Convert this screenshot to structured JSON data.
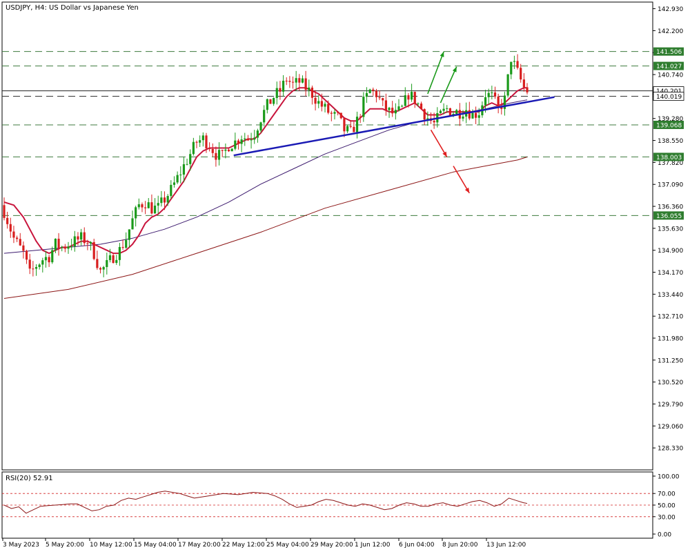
{
  "header": {
    "title": "USDJPY, H4:  US Dollar vs Japanese Yen"
  },
  "colors": {
    "bull_candle": "#1a9a1a",
    "bear_candle": "#d81e1e",
    "ma_fast": "#c8143c",
    "ma_mid": "#3c1a6e",
    "ma_slow": "#8b1414",
    "trendline": "#1a1ab4",
    "level_dash": "#3c7a3c",
    "level_label_bg": "#2f7d2f",
    "arrow_up": "#1a9a1a",
    "arrow_down": "#e02020",
    "rsi_line": "#8b1414",
    "rsi_levels": "#d22020"
  },
  "chart_data": [
    {
      "type": "candlestick",
      "symbol": "USDJPY",
      "timeframe": "H4",
      "ylim": [
        127.6,
        143.15
      ],
      "y_ticks": [
        "142.930",
        "142.200",
        "141.470",
        "140.740",
        "140.010",
        "139.280",
        "138.550",
        "137.820",
        "137.090",
        "136.360",
        "135.630",
        "134.900",
        "134.170",
        "133.440",
        "132.710",
        "131.980",
        "131.250",
        "130.520",
        "129.790",
        "129.060",
        "128.330"
      ],
      "x_labels": [
        "3 May 2023",
        "5 May 20:00",
        "10 May 12:00",
        "15 May 04:00",
        "17 May 20:00",
        "22 May 12:00",
        "25 May 04:00",
        "29 May 20:00",
        "1 Jun 12:00",
        "6 Jun 04:00",
        "8 Jun 20:00",
        "13 Jun 12:00"
      ],
      "price_levels": [
        {
          "value": 141.506,
          "label": "141.506",
          "style": "dashed-labeled"
        },
        {
          "value": 141.027,
          "label": "141.027",
          "style": "dashed-labeled"
        },
        {
          "value": 140.201,
          "label": "140.201",
          "style": "solid-current"
        },
        {
          "value": 140.019,
          "label": "140.019",
          "style": "dashed-dark"
        },
        {
          "value": 139.068,
          "label": "139.068",
          "style": "dashed-labeled"
        },
        {
          "value": 138.003,
          "label": "138.003",
          "style": "dashed-labeled"
        },
        {
          "value": 136.055,
          "label": "136.055",
          "style": "dashed-labeled"
        }
      ],
      "close_path": [
        [
          0,
          136.2
        ],
        [
          3,
          135.3
        ],
        [
          6,
          134.8
        ],
        [
          8,
          134.1
        ],
        [
          10,
          134.4
        ],
        [
          12,
          134.6
        ],
        [
          14,
          134.7
        ],
        [
          16,
          135.1
        ],
        [
          18,
          135.0
        ],
        [
          20,
          135.1
        ],
        [
          22,
          135.2
        ],
        [
          24,
          135.3
        ],
        [
          26,
          135.2
        ],
        [
          28,
          134.8
        ],
        [
          30,
          134.2
        ],
        [
          32,
          134.4
        ],
        [
          34,
          134.7
        ],
        [
          36,
          134.9
        ],
        [
          38,
          135.3
        ],
        [
          40,
          135.9
        ],
        [
          42,
          136.4
        ],
        [
          44,
          136.5
        ],
        [
          46,
          136.3
        ],
        [
          48,
          136.3
        ],
        [
          50,
          136.6
        ],
        [
          52,
          136.9
        ],
        [
          54,
          137.3
        ],
        [
          56,
          137.7
        ],
        [
          58,
          138.1
        ],
        [
          60,
          138.5
        ],
        [
          62,
          138.6
        ],
        [
          64,
          138.4
        ],
        [
          66,
          138.1
        ],
        [
          68,
          138.0
        ],
        [
          70,
          138.4
        ],
        [
          72,
          138.5
        ],
        [
          74,
          138.7
        ],
        [
          76,
          138.6
        ],
        [
          78,
          138.8
        ],
        [
          80,
          139.3
        ],
        [
          82,
          139.7
        ],
        [
          84,
          140.0
        ],
        [
          86,
          140.2
        ],
        [
          88,
          140.6
        ],
        [
          90,
          140.4
        ],
        [
          92,
          140.5
        ],
        [
          94,
          140.3
        ],
        [
          96,
          140.1
        ],
        [
          98,
          139.8
        ],
        [
          100,
          139.6
        ],
        [
          102,
          139.4
        ],
        [
          104,
          139.3
        ],
        [
          106,
          138.9
        ],
        [
          108,
          138.8
        ],
        [
          110,
          139.2
        ],
        [
          112,
          139.8
        ],
        [
          114,
          140.2
        ],
        [
          116,
          140.1
        ],
        [
          118,
          139.7
        ],
        [
          120,
          139.5
        ],
        [
          122,
          139.4
        ],
        [
          124,
          139.6
        ],
        [
          126,
          140.1
        ],
        [
          128,
          139.9
        ],
        [
          130,
          139.6
        ],
        [
          132,
          139.3
        ],
        [
          134,
          139.1
        ],
        [
          136,
          139.4
        ],
        [
          138,
          139.6
        ],
        [
          140,
          139.5
        ],
        [
          142,
          139.5
        ],
        [
          144,
          139.6
        ],
        [
          146,
          139.4
        ],
        [
          148,
          139.5
        ],
        [
          150,
          140.1
        ],
        [
          152,
          140.0
        ],
        [
          154,
          139.6
        ],
        [
          156,
          139.9
        ],
        [
          158,
          141.3
        ],
        [
          160,
          140.8
        ],
        [
          162,
          140.3
        ],
        [
          163,
          140.2
        ]
      ],
      "ma_fast_path": [
        [
          0,
          136.5
        ],
        [
          3,
          136.4
        ],
        [
          6,
          136.0
        ],
        [
          8,
          135.6
        ],
        [
          10,
          135.2
        ],
        [
          12,
          134.9
        ],
        [
          14,
          134.8
        ],
        [
          16,
          134.9
        ],
        [
          18,
          135.0
        ],
        [
          20,
          135.0
        ],
        [
          22,
          135.1
        ],
        [
          24,
          135.2
        ],
        [
          26,
          135.2
        ],
        [
          28,
          135.1
        ],
        [
          30,
          135.0
        ],
        [
          32,
          134.9
        ],
        [
          34,
          134.8
        ],
        [
          36,
          134.8
        ],
        [
          38,
          134.9
        ],
        [
          40,
          135.1
        ],
        [
          42,
          135.4
        ],
        [
          44,
          135.8
        ],
        [
          46,
          136.0
        ],
        [
          48,
          136.1
        ],
        [
          50,
          136.3
        ],
        [
          52,
          136.6
        ],
        [
          54,
          136.9
        ],
        [
          56,
          137.2
        ],
        [
          58,
          137.6
        ],
        [
          60,
          138.0
        ],
        [
          62,
          138.2
        ],
        [
          64,
          138.3
        ],
        [
          66,
          138.3
        ],
        [
          68,
          138.3
        ],
        [
          70,
          138.3
        ],
        [
          72,
          138.4
        ],
        [
          74,
          138.5
        ],
        [
          76,
          138.6
        ],
        [
          78,
          138.6
        ],
        [
          80,
          138.8
        ],
        [
          82,
          139.1
        ],
        [
          84,
          139.4
        ],
        [
          86,
          139.7
        ],
        [
          88,
          140.0
        ],
        [
          90,
          140.2
        ],
        [
          92,
          140.3
        ],
        [
          94,
          140.3
        ],
        [
          96,
          140.2
        ],
        [
          98,
          140.1
        ],
        [
          100,
          139.9
        ],
        [
          102,
          139.7
        ],
        [
          104,
          139.5
        ],
        [
          106,
          139.3
        ],
        [
          108,
          139.2
        ],
        [
          110,
          139.2
        ],
        [
          112,
          139.4
        ],
        [
          114,
          139.6
        ],
        [
          116,
          139.6
        ],
        [
          118,
          139.6
        ],
        [
          120,
          139.5
        ],
        [
          122,
          139.5
        ],
        [
          124,
          139.6
        ],
        [
          126,
          139.7
        ],
        [
          128,
          139.8
        ],
        [
          130,
          139.6
        ],
        [
          132,
          139.4
        ],
        [
          134,
          139.4
        ],
        [
          136,
          139.4
        ],
        [
          138,
          139.5
        ],
        [
          140,
          139.5
        ],
        [
          142,
          139.5
        ],
        [
          144,
          139.5
        ],
        [
          146,
          139.5
        ],
        [
          148,
          139.5
        ],
        [
          150,
          139.7
        ],
        [
          152,
          139.8
        ],
        [
          154,
          139.7
        ],
        [
          156,
          139.8
        ],
        [
          158,
          140.0
        ],
        [
          160,
          140.2
        ],
        [
          162,
          140.3
        ],
        [
          163,
          140.3
        ]
      ],
      "ma_mid_path": [
        [
          0,
          134.8
        ],
        [
          10,
          134.9
        ],
        [
          20,
          135.0
        ],
        [
          30,
          135.1
        ],
        [
          40,
          135.3
        ],
        [
          50,
          135.6
        ],
        [
          60,
          136.0
        ],
        [
          70,
          136.5
        ],
        [
          80,
          137.1
        ],
        [
          90,
          137.6
        ],
        [
          100,
          138.1
        ],
        [
          110,
          138.5
        ],
        [
          120,
          138.9
        ],
        [
          130,
          139.2
        ],
        [
          140,
          139.4
        ],
        [
          150,
          139.6
        ],
        [
          158,
          139.8
        ],
        [
          163,
          139.9
        ]
      ],
      "ma_slow_path": [
        [
          0,
          133.3
        ],
        [
          20,
          133.6
        ],
        [
          40,
          134.1
        ],
        [
          60,
          134.8
        ],
        [
          80,
          135.5
        ],
        [
          100,
          136.3
        ],
        [
          120,
          136.9
        ],
        [
          140,
          137.5
        ],
        [
          160,
          137.9
        ],
        [
          163,
          138.0
        ]
      ],
      "trendline": [
        [
          78,
          138.1
        ],
        [
          150,
          139.9
        ]
      ],
      "arrows": [
        {
          "color": "up",
          "from": [
            132,
            140.1
          ],
          "to": [
            137,
            141.5
          ]
        },
        {
          "color": "up",
          "from": [
            136,
            139.8
          ],
          "to": [
            141,
            141.0
          ]
        },
        {
          "color": "down",
          "from": [
            133,
            138.9
          ],
          "to": [
            138,
            138.0
          ]
        },
        {
          "color": "down",
          "from": [
            140,
            137.7
          ],
          "to": [
            145,
            136.8
          ]
        }
      ]
    },
    {
      "type": "line",
      "indicator": "RSI(20)",
      "label": "RSI(20) 52.91",
      "value": 52.91,
      "ylim": [
        0,
        100
      ],
      "y_ticks": [
        "100.00",
        "70.00",
        "50.00",
        "30.00",
        "0.00"
      ],
      "levels": [
        70,
        50,
        30
      ],
      "values": [
        [
          0,
          50
        ],
        [
          2,
          44
        ],
        [
          4,
          47
        ],
        [
          6,
          36
        ],
        [
          8,
          42
        ],
        [
          10,
          48
        ],
        [
          12,
          49
        ],
        [
          14,
          50
        ],
        [
          16,
          51
        ],
        [
          18,
          52
        ],
        [
          20,
          52
        ],
        [
          22,
          46
        ],
        [
          24,
          40
        ],
        [
          26,
          42
        ],
        [
          28,
          48
        ],
        [
          30,
          50
        ],
        [
          32,
          58
        ],
        [
          34,
          62
        ],
        [
          36,
          60
        ],
        [
          38,
          64
        ],
        [
          40,
          68
        ],
        [
          42,
          72
        ],
        [
          44,
          74
        ],
        [
          46,
          72
        ],
        [
          48,
          70
        ],
        [
          50,
          66
        ],
        [
          52,
          62
        ],
        [
          54,
          64
        ],
        [
          56,
          66
        ],
        [
          58,
          68
        ],
        [
          60,
          70
        ],
        [
          62,
          69
        ],
        [
          64,
          68
        ],
        [
          66,
          70
        ],
        [
          68,
          72
        ],
        [
          70,
          71
        ],
        [
          72,
          70
        ],
        [
          74,
          66
        ],
        [
          76,
          60
        ],
        [
          78,
          52
        ],
        [
          80,
          46
        ],
        [
          82,
          48
        ],
        [
          84,
          50
        ],
        [
          86,
          56
        ],
        [
          88,
          60
        ],
        [
          90,
          58
        ],
        [
          92,
          54
        ],
        [
          94,
          50
        ],
        [
          96,
          48
        ],
        [
          98,
          52
        ],
        [
          100,
          50
        ],
        [
          102,
          46
        ],
        [
          104,
          42
        ],
        [
          106,
          44
        ],
        [
          108,
          50
        ],
        [
          110,
          54
        ],
        [
          112,
          52
        ],
        [
          114,
          48
        ],
        [
          116,
          48
        ],
        [
          118,
          52
        ],
        [
          120,
          54
        ],
        [
          122,
          50
        ],
        [
          124,
          48
        ],
        [
          126,
          52
        ],
        [
          128,
          56
        ],
        [
          130,
          58
        ],
        [
          132,
          54
        ],
        [
          134,
          48
        ],
        [
          136,
          52
        ],
        [
          138,
          62
        ],
        [
          140,
          58
        ],
        [
          142,
          54
        ],
        [
          143,
          52.91
        ]
      ]
    }
  ]
}
